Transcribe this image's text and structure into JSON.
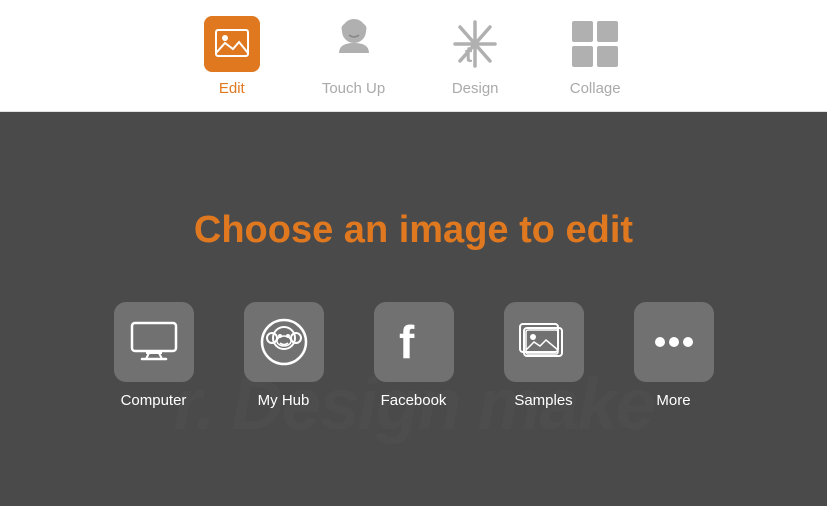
{
  "nav": {
    "items": [
      {
        "id": "edit",
        "label": "Edit",
        "active": true
      },
      {
        "id": "touchup",
        "label": "Touch Up",
        "active": false
      },
      {
        "id": "design",
        "label": "Design",
        "active": false
      },
      {
        "id": "collage",
        "label": "Collage",
        "active": false
      }
    ]
  },
  "main": {
    "title": "Choose an image to edit",
    "watermark": "r. Design make",
    "sources": [
      {
        "id": "computer",
        "label": "Computer"
      },
      {
        "id": "myhub",
        "label": "My Hub"
      },
      {
        "id": "facebook",
        "label": "Facebook"
      },
      {
        "id": "samples",
        "label": "Samples"
      },
      {
        "id": "more",
        "label": "More"
      }
    ]
  }
}
